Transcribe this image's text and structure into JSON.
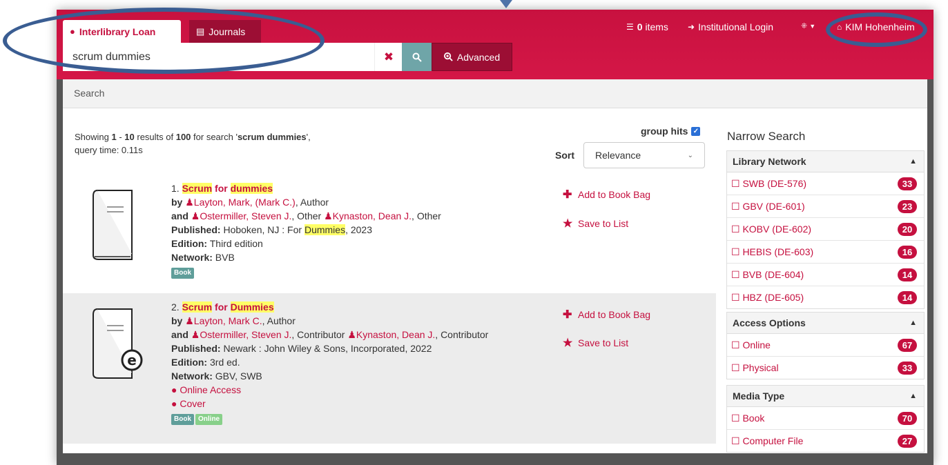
{
  "colors": {
    "brand": "#c5103f",
    "brand_dark": "#9c0e34",
    "search_button": "#6fa5a8",
    "annotation": "#3a5d92",
    "highlight": "#ffff66"
  },
  "tabs": [
    {
      "label": "Interlibrary Loan",
      "icon": "globe-icon",
      "active": true
    },
    {
      "label": "Journals",
      "icon": "newspaper-icon",
      "active": false
    }
  ],
  "search": {
    "value": "scrum dummies",
    "advanced_label": "Advanced"
  },
  "topnav": {
    "items_count": "0",
    "items_label": " items",
    "login": "Institutional Login",
    "language_icon": "uk-flag-icon",
    "library": "KIM Hohenheim"
  },
  "breadcrumb": "Search",
  "summary": {
    "prefix": "Showing ",
    "start": "1",
    "dash": " - ",
    "end": "10",
    "mid": " results of ",
    "total": "100",
    "for": " for search '",
    "query": "scrum dummies",
    "suffix": "',",
    "query_time": "query time: 0.11s"
  },
  "group_hits": "group hits",
  "sort": {
    "label": "Sort",
    "selected": "Relevance"
  },
  "results": [
    {
      "num": "1.",
      "title_a": "Scrum",
      "title_b": " for ",
      "title_c": "dummies",
      "by": "by ",
      "author": "Layton, Mark, (Mark C.)",
      "author_role": ", Author",
      "and": "and ",
      "other1": "Ostermiller, Steven J.",
      "other1_role": ", Other ",
      "other2": "Kynaston, Dean J.",
      "other2_role": ", Other",
      "published_label": "Published:",
      "published_a": " Hoboken, NJ : For ",
      "published_hl": "Dummies",
      "published_b": ", 2023",
      "edition_label": "Edition:",
      "edition": " Third edition",
      "network_label": "Network:",
      "network": " BVB",
      "badge": "Book",
      "add_label": "Add to Book Bag",
      "save_label": "Save to List"
    },
    {
      "num": "2.",
      "title_a": "Scrum",
      "title_b": " for ",
      "title_c": "Dummies",
      "by": "by ",
      "author": "Layton, Mark C.",
      "author_role": ", Author",
      "and": "and ",
      "other1": "Ostermiller, Steven J.",
      "other1_role": ", Contributor ",
      "other2": "Kynaston, Dean J.",
      "other2_role": ", Contributor",
      "published_label": "Published:",
      "published": " Newark : John Wiley & Sons, Incorporated, 2022",
      "edition_label": "Edition:",
      "edition": " 3rd ed.",
      "network_label": "Network:",
      "network": " GBV, SWB",
      "online_access": "Online Access",
      "cover": "Cover",
      "badge": "Book",
      "badge2": "Online",
      "add_label": "Add to Book Bag",
      "save_label": "Save to List"
    }
  ],
  "narrow": {
    "title": "Narrow Search",
    "library_network": {
      "heading": "Library Network",
      "items": [
        {
          "label": "☐ SWB (DE-576)",
          "count": "33"
        },
        {
          "label": "☐ GBV (DE-601)",
          "count": "23"
        },
        {
          "label": "☐ KOBV (DE-602)",
          "count": "20"
        },
        {
          "label": "☐ HEBIS (DE-603)",
          "count": "16"
        },
        {
          "label": "☐ BVB (DE-604)",
          "count": "14"
        },
        {
          "label": "☐ HBZ (DE-605)",
          "count": "14"
        }
      ]
    },
    "access_options": {
      "heading": "Access Options",
      "items": [
        {
          "label": "☐ Online",
          "count": "67"
        },
        {
          "label": "☐ Physical",
          "count": "33"
        }
      ]
    },
    "media_type": {
      "heading": "Media Type",
      "items": [
        {
          "label": "☐ Book",
          "count": "70"
        },
        {
          "label": "☐ Computer File",
          "count": "27"
        }
      ]
    }
  }
}
